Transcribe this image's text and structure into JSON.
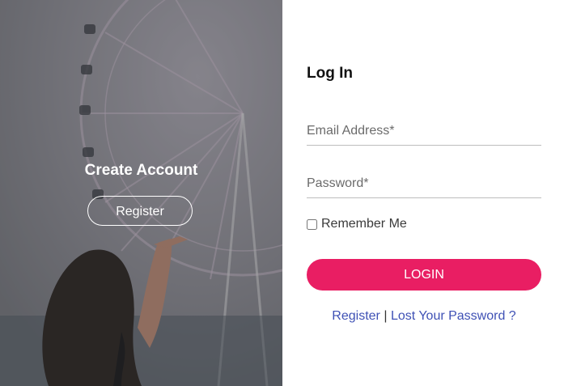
{
  "left_panel": {
    "heading": "Create Account",
    "register_button": "Register"
  },
  "login_form": {
    "title": "Log In",
    "email_placeholder": "Email Address*",
    "password_placeholder": "Password*",
    "remember_label": "Remember Me",
    "login_button": "LOGIN",
    "register_link": "Register",
    "separator": "|",
    "lost_password_link": "Lost Your Password ?"
  },
  "colors": {
    "accent": "#e91e63",
    "link": "#3f51b5"
  }
}
